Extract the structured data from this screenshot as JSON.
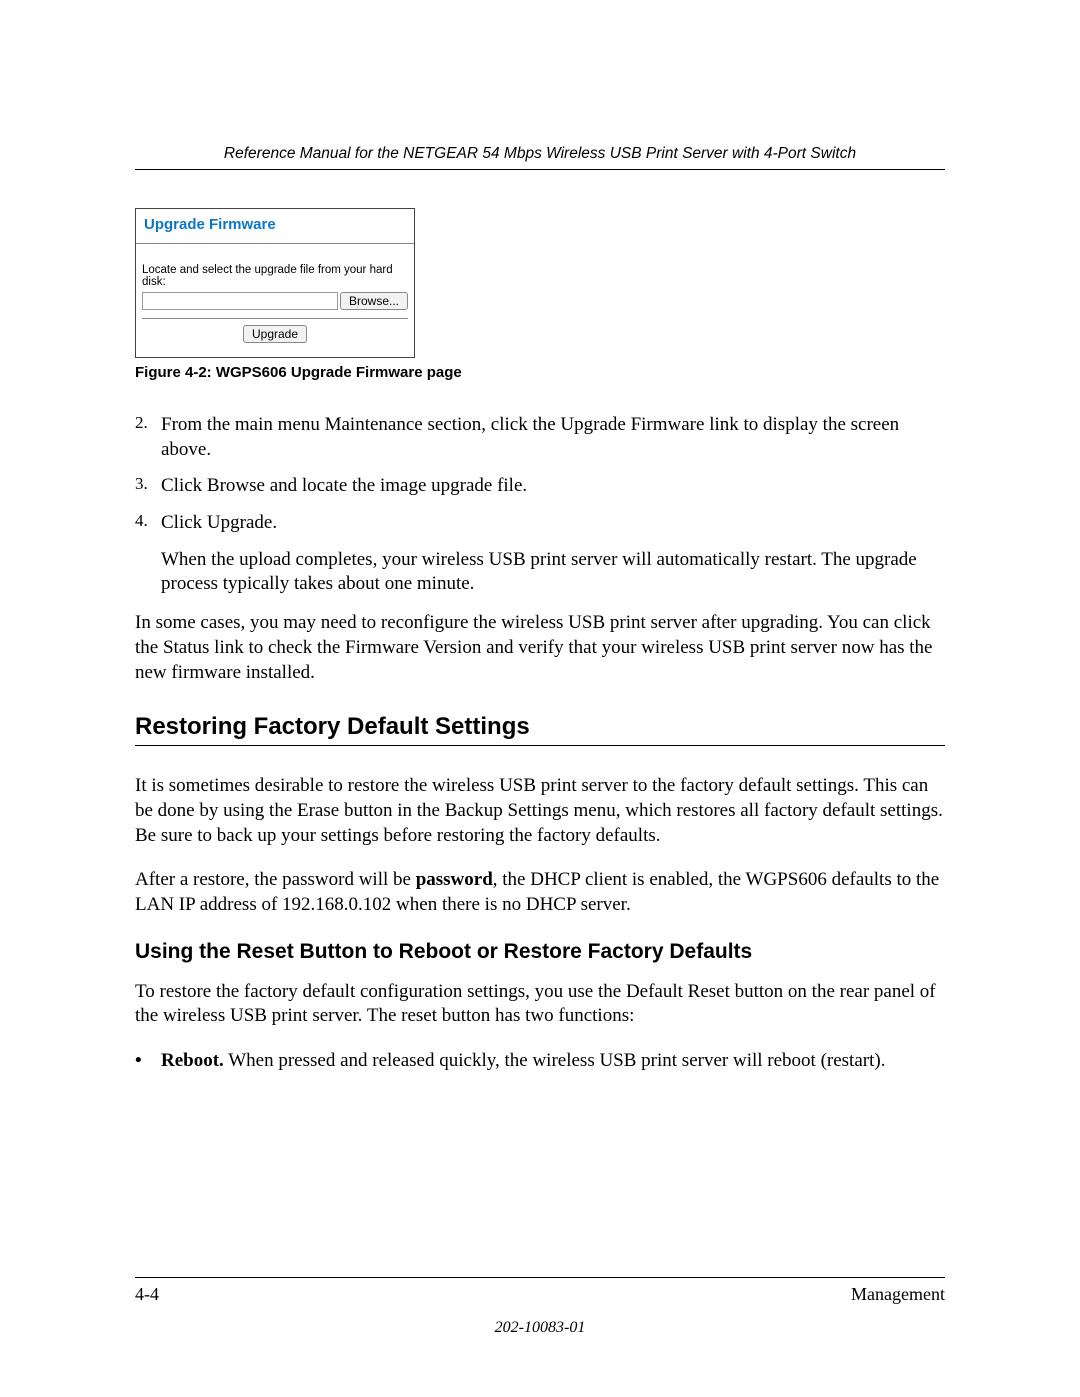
{
  "header": "Reference Manual for the NETGEAR 54 Mbps Wireless USB Print Server with 4-Port Switch",
  "figure_box": {
    "title": "Upgrade Firmware",
    "instruction": "Locate and select the upgrade file from your hard disk:",
    "browse_label": "Browse...",
    "upgrade_label": "Upgrade"
  },
  "figure_caption": "Figure 4-2:  WGPS606 Upgrade Firmware page",
  "steps": {
    "n2": "2.",
    "s2": "From the main menu Maintenance section, click the Upgrade Firmware link to display the screen above.",
    "n3": "3.",
    "s3": "Click Browse and locate the image upgrade file.",
    "n4": "4.",
    "s4": "Click Upgrade.",
    "s4b": "When the upload completes, your wireless USB print server will automatically restart. The upgrade process typically takes about one minute."
  },
  "para_after_steps": "In some cases, you may need to reconfigure the wireless USB print server after upgrading. You can click the Status link to check the Firmware Version and verify that your wireless USB print server now has the new firmware installed.",
  "h2_restore": "Restoring Factory Default Settings",
  "restore_p1": "It is sometimes desirable to restore the wireless USB print server to the factory default settings. This can be done by using the Erase button in the Backup Settings menu, which restores all factory default settings. Be sure to back up your settings before restoring the factory defaults.",
  "restore_p2_a": "After a restore, the password will be ",
  "restore_p2_bold": "password",
  "restore_p2_b": ", the DHCP client is enabled, the WGPS606 defaults to the LAN IP address of 192.168.0.102 when there is no DHCP server.",
  "h3_reset": "Using the Reset Button to Reboot or Restore Factory Defaults",
  "reset_p1": "To restore the factory default configuration settings, you use the Default Reset button on the rear panel of the wireless USB print server. The reset button has two functions:",
  "bullet_dot": "•",
  "bullet1_bold": "Reboot.",
  "bullet1_rest": " When pressed and released quickly, the wireless USB print server will reboot (restart).",
  "footer_left": "4-4",
  "footer_right": "Management",
  "docnum": "202-10083-01"
}
